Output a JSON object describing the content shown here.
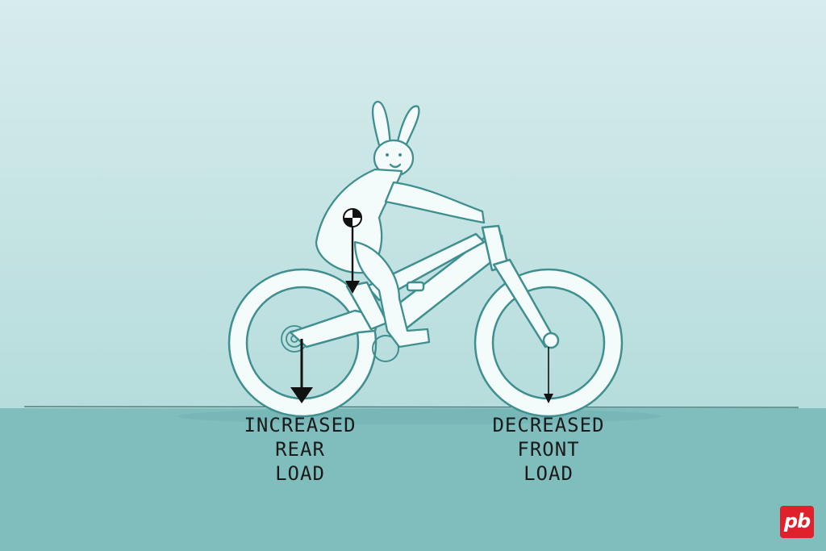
{
  "labels": {
    "rear": "INCREASED\nREAR\nLOAD",
    "front": "DECREASED\nFRONT\nLOAD"
  },
  "logo_text": "pb",
  "colors": {
    "sky_top": "#d4eaea",
    "sky_bottom": "#b7dcdc",
    "ground": "#7fbdbd",
    "bike_fill": "#f4fbfb",
    "outline": "#3f8f90",
    "arrow": "#111111",
    "logo": "#e0202a"
  }
}
